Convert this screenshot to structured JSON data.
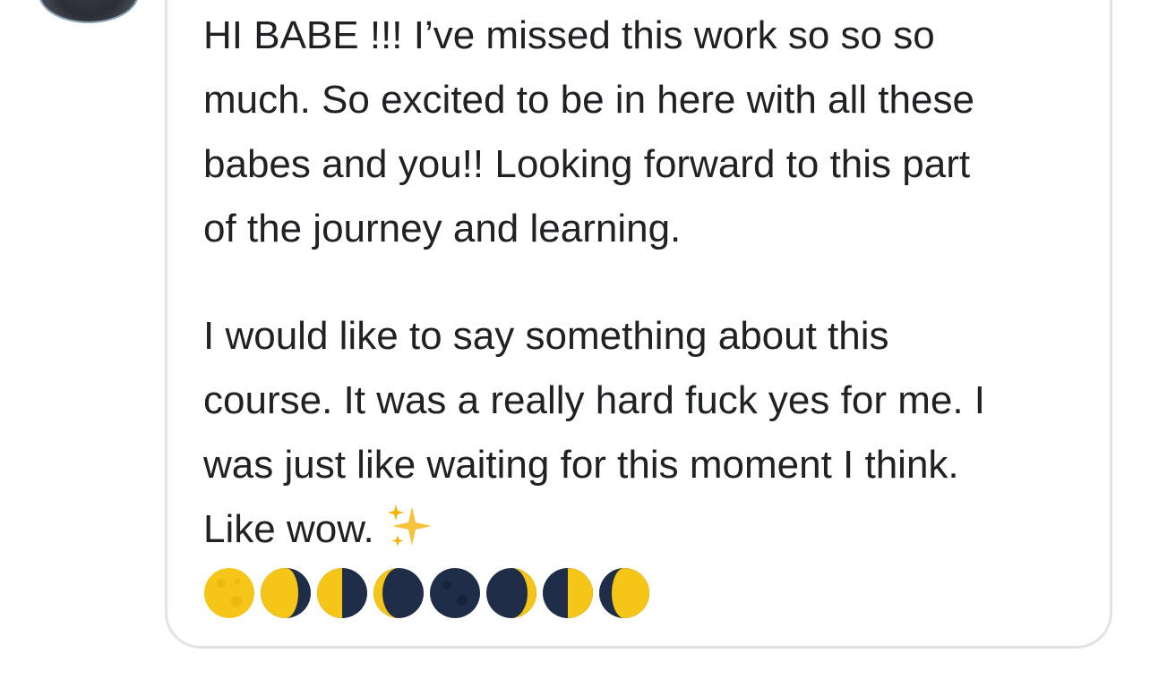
{
  "comment": {
    "paragraphs": [
      "HI BABE !!! I’ve missed this work so so so\nmuch. So excited to be in here with all these\nbabes and you!! Looking forward to this part\nof the journey and learning.",
      "I would like to say something about this\ncourse. It was a really hard fuck yes for me. I\nwas just like waiting for this moment I think.\nLike wow."
    ],
    "trailing_emoji": "sparkles",
    "moon_phases": [
      "full-moon",
      "waning-gibbous-moon",
      "last-quarter-moon",
      "waning-crescent-moon",
      "new-moon",
      "waxing-crescent-moon",
      "first-quarter-moon",
      "waxing-gibbous-moon"
    ]
  },
  "colors": {
    "text": "#202124",
    "bubble_border": "#e3e3e3",
    "moon_yellow": "#f5c518",
    "moon_dark": "#1f2d49"
  }
}
